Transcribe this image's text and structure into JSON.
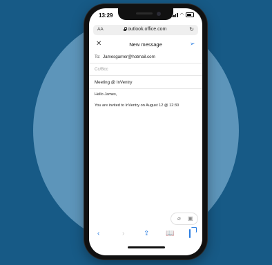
{
  "status_bar": {
    "time": "13:29"
  },
  "browser": {
    "text_size_label": "AA",
    "url": "outlook.office.com"
  },
  "compose": {
    "title": "New message",
    "to_label": "To:",
    "to_value": "Jamesgarner@hotmail.com",
    "cc_placeholder": "Cc/Bcc",
    "subject": "Meeting @ InVentry",
    "greeting": "Hello James,",
    "message": "You are invited to InVentry on August 12 @ 12:30"
  },
  "icons": {
    "close": "close-icon",
    "send": "send-icon",
    "attach": "paperclip-icon",
    "image": "image-icon",
    "reload": "reload-icon",
    "lock": "lock-icon"
  },
  "colors": {
    "background": "#175a86",
    "circle": "#5d95ba",
    "accent": "#2a7de1"
  }
}
